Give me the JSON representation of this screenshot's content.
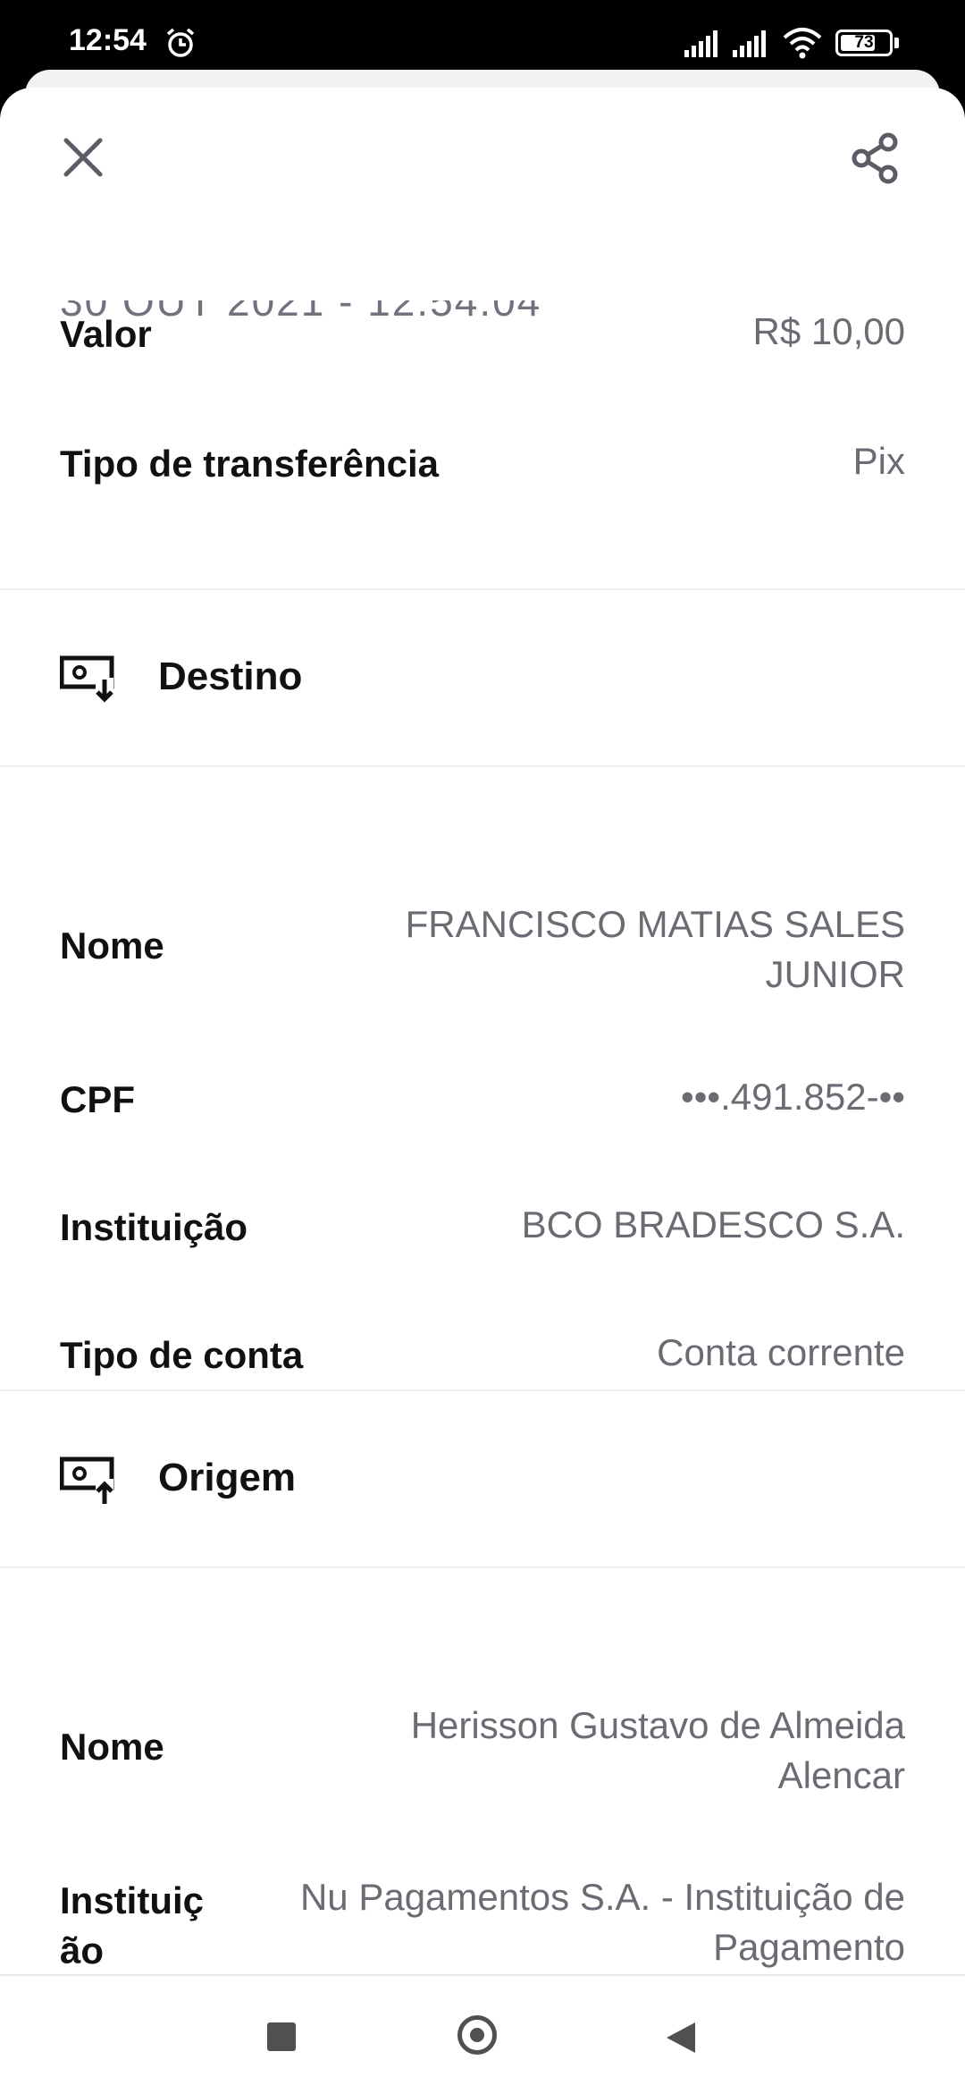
{
  "status_bar": {
    "time": "12:54",
    "battery": "73",
    "battery_percent": 73,
    "icons": [
      "alarm-icon",
      "signal-icon",
      "signal-icon",
      "wifi-icon",
      "battery-icon"
    ]
  },
  "header": {
    "close_icon": "close-icon",
    "share_icon": "share-icon",
    "clipped_datetime": "30 OUT 2021 - 12:54:04"
  },
  "summary": [
    {
      "label": "Valor",
      "value": "R$ 10,00"
    },
    {
      "label": "Tipo de transferência",
      "value": "Pix"
    }
  ],
  "destino": {
    "title": "Destino",
    "icon": "receive-money-icon",
    "nome_label": "Nome",
    "nome_line1": "FRANCISCO MATIAS SALES",
    "nome_line2": "JUNIOR",
    "cpf_label": "CPF",
    "cpf_value": "•••.491.852-••",
    "instituicao_label": "Instituição",
    "instituicao_value": "BCO BRADESCO S.A.",
    "tipo_conta_label": "Tipo de conta",
    "tipo_conta_value": "Conta corrente"
  },
  "origem": {
    "title": "Origem",
    "icon": "send-money-icon",
    "nome_label": "Nome",
    "nome_line1": "Herisson Gustavo de Almeida",
    "nome_line2": "Alencar",
    "instituicao_label_line1": "Instituiç",
    "instituicao_label_line2": "ão",
    "instituicao_line1": "Nu Pagamentos S.A. - Instituição de",
    "instituicao_line2": "Pagamento"
  },
  "colors": {
    "label": "#111111",
    "value": "#6d6a73",
    "divider": "#ececef",
    "background": "#ffffff"
  },
  "nav_bar": {
    "icons": [
      "recents-square-icon",
      "home-circle-icon",
      "back-triangle-icon"
    ]
  }
}
